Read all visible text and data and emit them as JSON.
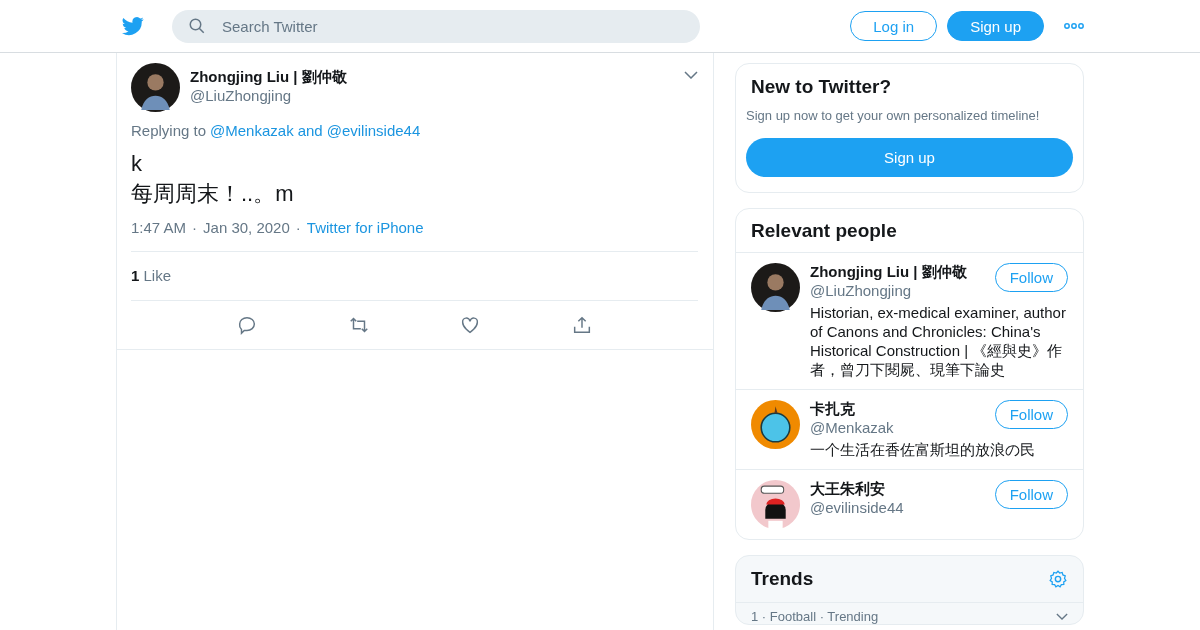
{
  "header": {
    "search": {
      "placeholder": "Search Twitter"
    },
    "buttons": [
      {
        "label": "Log in",
        "kind": "outline"
      },
      {
        "label": "Sign up",
        "kind": "filled"
      }
    ]
  },
  "tweet": {
    "name": "Zhongjing Liu | 劉仲敬",
    "handle": "@LiuZhongjing",
    "replying_label": "Replying to",
    "reply_to": [
      "@Menkazak",
      "@evilinside44"
    ],
    "reply_joiner": "and",
    "lines": [
      "k",
      "每周周末！..。m"
    ],
    "time": "1:47 AM",
    "separator": "·",
    "date": "Jan 30, 2020",
    "source": "Twitter for iPhone",
    "like_count": "1",
    "like_label": "Like"
  },
  "new_to_twitter": {
    "title": "New to Twitter?",
    "text": "Sign up now to get your own personalized timeline!",
    "button": "Sign up"
  },
  "relevant_people": {
    "title": "Relevant people",
    "people": [
      {
        "name": "Zhongjing Liu | 劉仲敬",
        "handle": "@LiuZhongjing",
        "bio": "Historian, ex-medical examiner, author of Canons and Chronicles: China's Historical Construction | 《經與史》作者，曾刀下閱屍、現筆下論史",
        "button": "Follow",
        "kind": "photo"
      },
      {
        "name": "卡扎克",
        "handle": "@Menkazak",
        "bio": "一个生活在香佐富斯坦的放浪の民",
        "button": "Follow",
        "kind": "bird"
      },
      {
        "name": "大王朱利安",
        "handle": "@evilinside44",
        "button": "Follow",
        "kind": "cartoon"
      }
    ]
  },
  "trends": {
    "title": "Trends",
    "items": [
      {
        "text": "1 · Football · Trending"
      }
    ]
  }
}
